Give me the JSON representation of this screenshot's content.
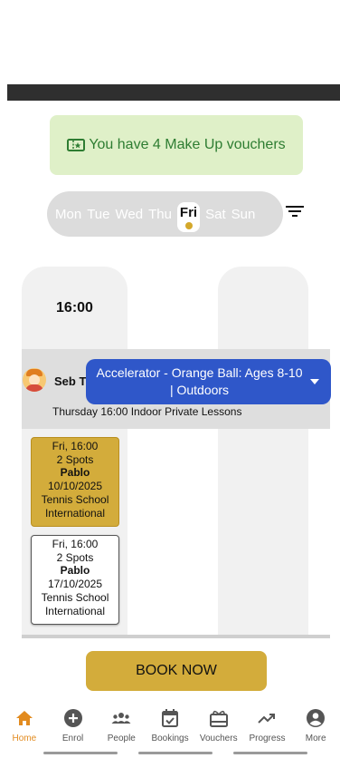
{
  "voucher": {
    "text": "You have 4 Make Up vouchers"
  },
  "days": [
    "Mon",
    "Tue",
    "Wed",
    "Thu",
    "Fri",
    "Sat",
    "Sun"
  ],
  "active_day": "Fri",
  "schedule": {
    "time": "16:00",
    "coach": "Seb T",
    "course": "Accelerator - Orange Ball: Ages 8-10 | Outdoors",
    "lesson": "Thursday 16:00 Indoor Private Lessons",
    "slots": [
      {
        "when": "Fri, 16:00",
        "spots": "2 Spots",
        "coach": "Pablo",
        "date": "10/10/2025",
        "loc1": "Tennis School",
        "loc2": "International"
      },
      {
        "when": "Fri, 16:00",
        "spots": "2 Spots",
        "coach": "Pablo",
        "date": "17/10/2025",
        "loc1": "Tennis School",
        "loc2": "International"
      }
    ]
  },
  "book_button": "BOOK NOW",
  "tabs": [
    "Home",
    "Enrol",
    "People",
    "Bookings",
    "Vouchers",
    "Progress",
    "More"
  ],
  "colors": {
    "accent": "#d3ac3b",
    "primary": "#2f57c9",
    "active_tab": "#e28b1f",
    "voucher_green": "#2e7d32"
  }
}
